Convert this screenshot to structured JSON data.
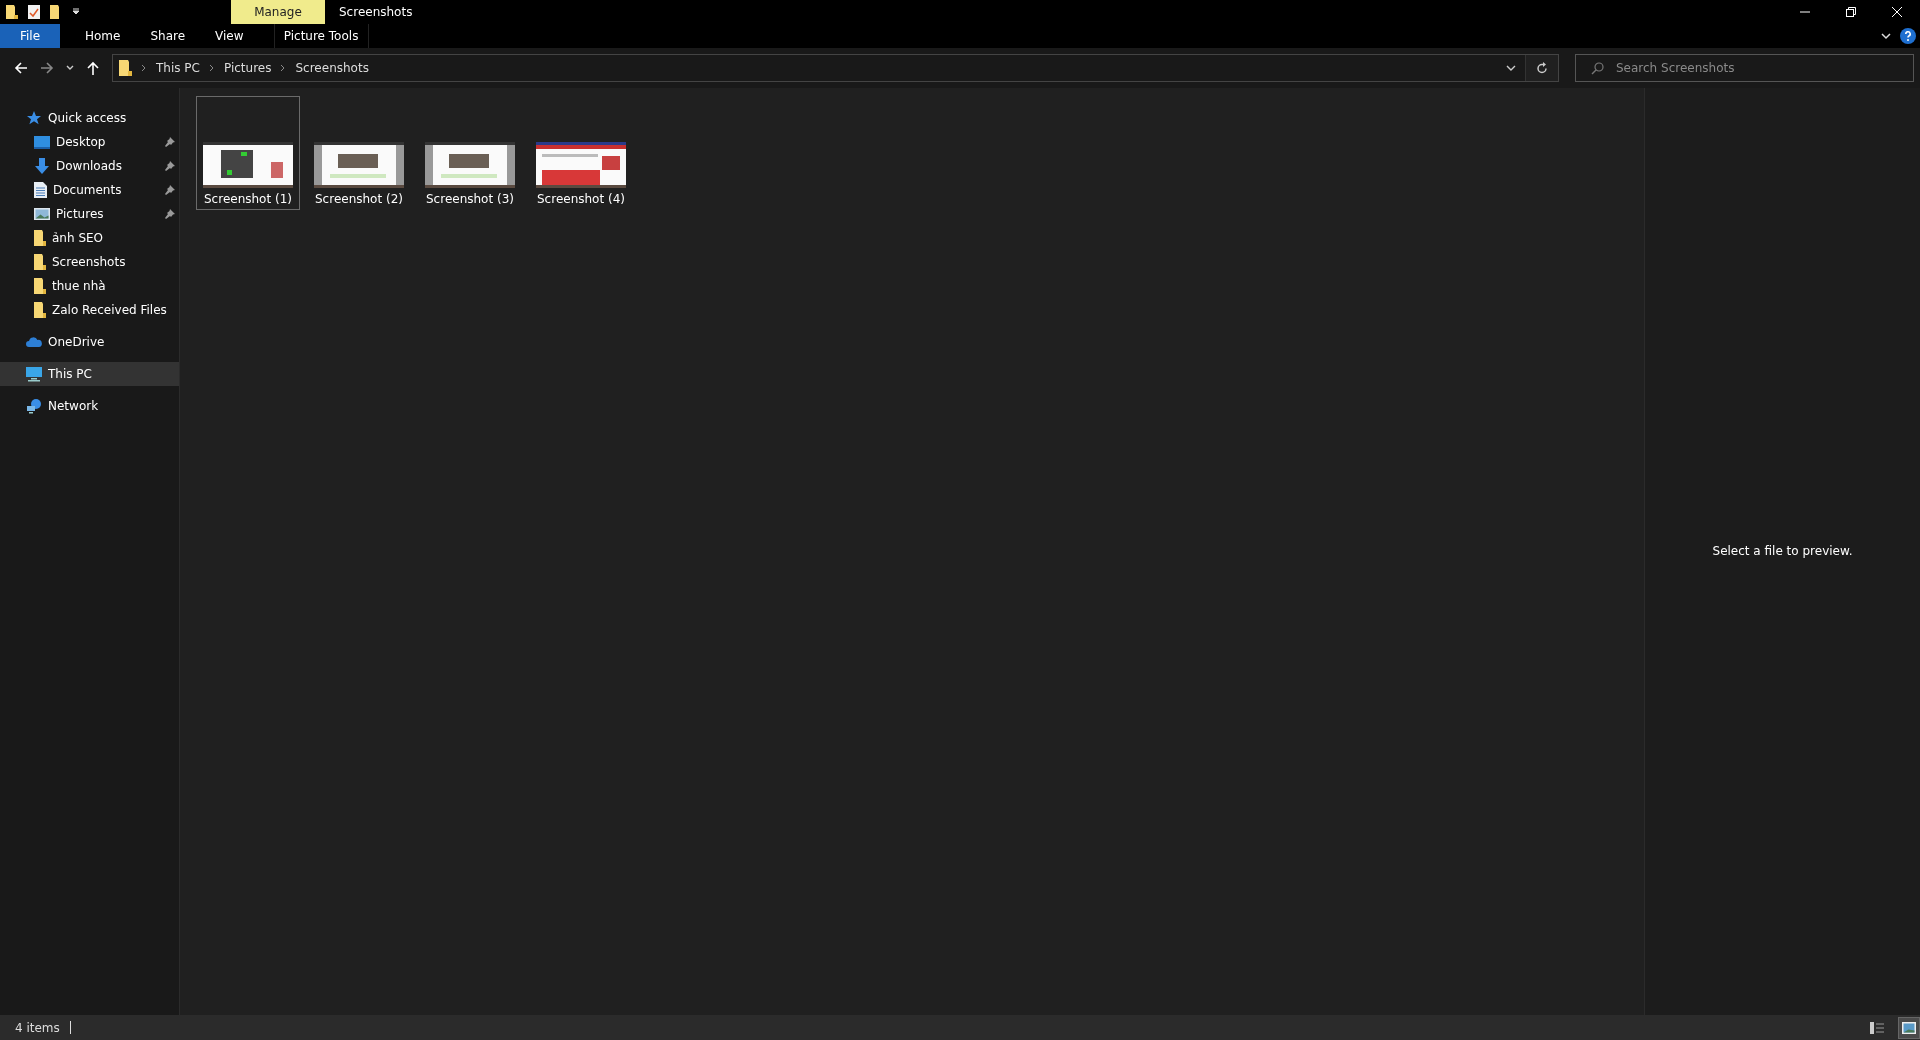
{
  "title_bar": {
    "context_tab": "Manage",
    "title": "Screenshots"
  },
  "ribbon_tabs": [
    {
      "label": "File",
      "kind": "file"
    },
    {
      "label": "Home",
      "kind": "plain"
    },
    {
      "label": "Share",
      "kind": "plain"
    },
    {
      "label": "View",
      "kind": "plain"
    },
    {
      "label": "Picture Tools",
      "kind": "context"
    }
  ],
  "address_bar": {
    "crumbs": [
      "This PC",
      "Pictures",
      "Screenshots"
    ]
  },
  "search": {
    "placeholder": "Search Screenshots"
  },
  "sidebar": [
    {
      "label": "Quick access",
      "kind": "star",
      "selected": false,
      "children": [
        {
          "label": "Desktop",
          "kind": "desktop",
          "pinned": true,
          "selected": false
        },
        {
          "label": "Downloads",
          "kind": "download",
          "pinned": true,
          "selected": false
        },
        {
          "label": "Documents",
          "kind": "document",
          "pinned": true,
          "selected": false
        },
        {
          "label": "Pictures",
          "kind": "pictures",
          "pinned": true,
          "selected": false
        },
        {
          "label": "ảnh SEO",
          "kind": "folder",
          "pinned": false,
          "selected": false
        },
        {
          "label": "Screenshots",
          "kind": "folder",
          "pinned": false,
          "selected": false
        },
        {
          "label": "thue nhà",
          "kind": "folder",
          "pinned": false,
          "selected": false
        },
        {
          "label": "Zalo Received Files",
          "kind": "folder",
          "pinned": false,
          "selected": false
        }
      ]
    },
    {
      "label": "OneDrive",
      "kind": "cloud",
      "selected": false
    },
    {
      "label": "This PC",
      "kind": "pc",
      "selected": true
    },
    {
      "label": "Network",
      "kind": "network",
      "selected": false
    }
  ],
  "files": [
    {
      "name": "Screenshot (1)",
      "selected": true
    },
    {
      "name": "Screenshot (2)",
      "selected": false
    },
    {
      "name": "Screenshot (3)",
      "selected": false
    },
    {
      "name": "Screenshot (4)",
      "selected": false
    }
  ],
  "preview": {
    "message": "Select a file to preview."
  },
  "status_bar": {
    "count": "4 items",
    "views": [
      {
        "kind": "details",
        "selected": false
      },
      {
        "kind": "large-icons",
        "selected": true
      }
    ]
  }
}
